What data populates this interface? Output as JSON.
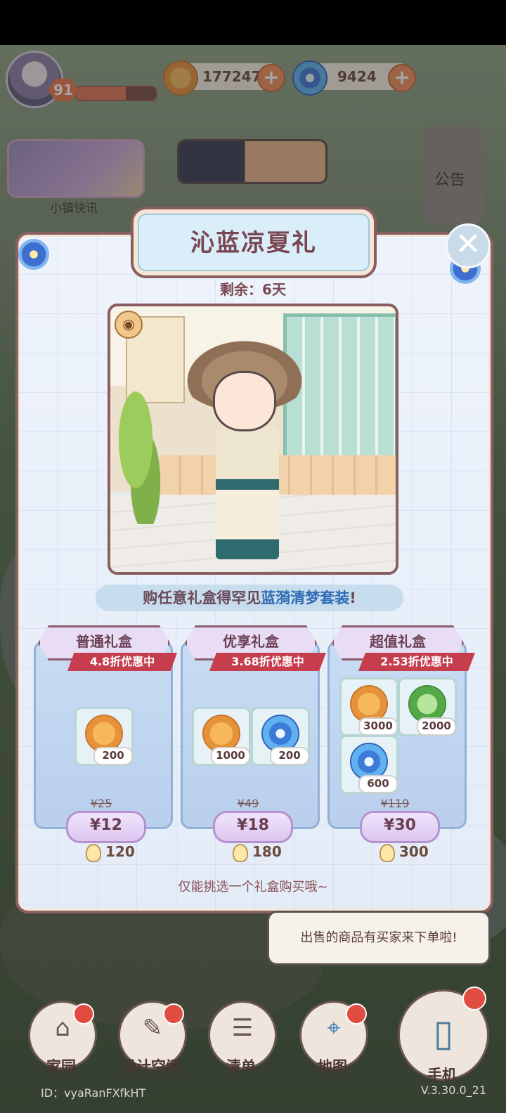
{
  "hud": {
    "level": "91",
    "currencies": [
      {
        "icon": "coin-icon",
        "value": "177247"
      },
      {
        "icon": "swirl-gem-icon",
        "value": "9424"
      }
    ]
  },
  "left": {
    "news_label": "小镇快讯"
  },
  "right": {
    "notice_label": "公告"
  },
  "popup": {
    "title": "沁蓝凉夏礼",
    "remaining": "剩余：6天",
    "banner_prefix": "购任意礼盒",
    "banner_mid": "得罕见",
    "banner_highlight": "蓝漪清梦套装",
    "banner_suffix": "!",
    "note": "仅能挑选一个礼盒购买哦~",
    "boxes": [
      {
        "title": "普通礼盒",
        "discount": "4.8折优惠中",
        "items": [
          {
            "icon": "coin-icon",
            "qty": "200"
          }
        ],
        "old_price": "¥25",
        "price": "¥12",
        "bulbs": "120"
      },
      {
        "title": "优享礼盒",
        "discount": "3.68折优惠中",
        "items": [
          {
            "icon": "coin-icon",
            "qty": "1000"
          },
          {
            "icon": "swirl-gem-icon",
            "qty": "200"
          }
        ],
        "old_price": "¥49",
        "price": "¥18",
        "bulbs": "180"
      },
      {
        "title": "超值礼盒",
        "discount": "2.53折优惠中",
        "items": [
          {
            "icon": "coin-icon",
            "qty": "3000"
          },
          {
            "icon": "leaf-icon",
            "qty": "2000"
          },
          {
            "icon": "swirl-gem-icon",
            "qty": "600"
          }
        ],
        "old_price": "¥119",
        "price": "¥30",
        "bulbs": "300"
      }
    ]
  },
  "speech": "出售的商品有买家来下单啦!",
  "nav": [
    {
      "label": "家园",
      "icon": "home-icon"
    },
    {
      "label": "设计空间",
      "icon": "design-icon"
    },
    {
      "label": "清单",
      "icon": "list-icon"
    },
    {
      "label": "地图",
      "icon": "map-pin-icon"
    },
    {
      "label": "手机",
      "icon": "phone-icon"
    }
  ],
  "footer": {
    "id": "ID：vyaRanFXfkHT",
    "version": "V.3.30.0_21"
  }
}
